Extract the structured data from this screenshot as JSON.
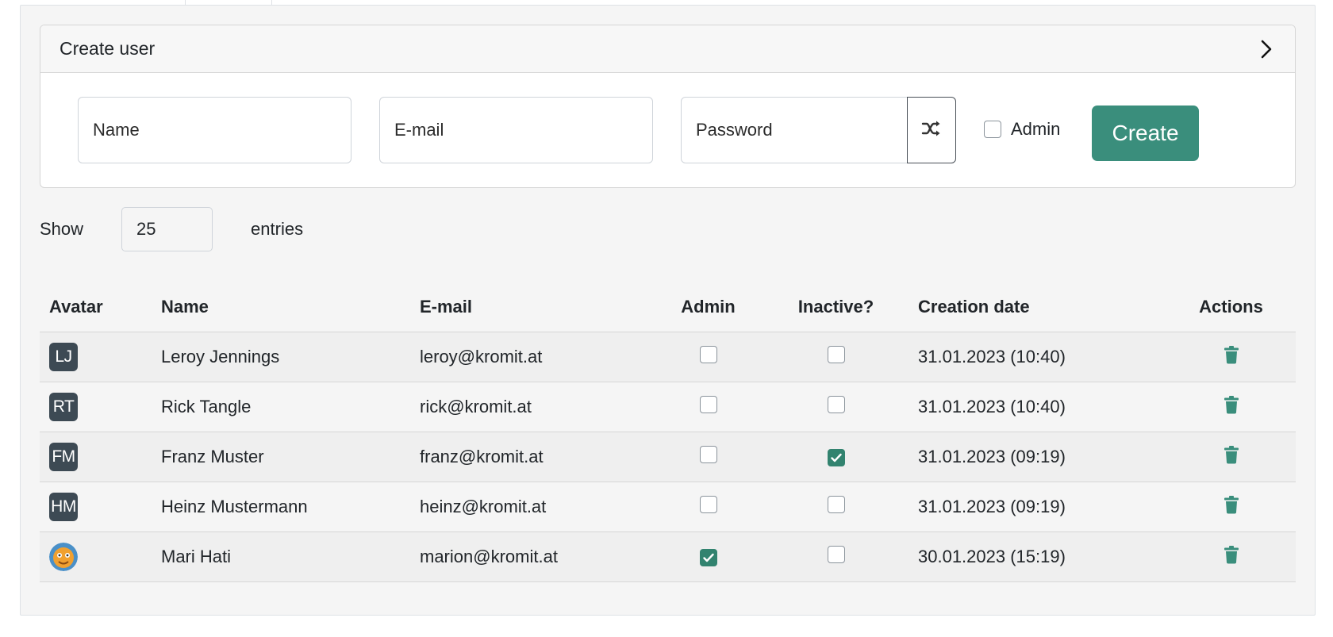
{
  "create_user": {
    "title": "Create user",
    "name_placeholder": "Name",
    "email_placeholder": "E-mail",
    "password_placeholder": "Password",
    "admin_label": "Admin",
    "admin_checked": false,
    "create_label": "Create"
  },
  "entries": {
    "show_label": "Show",
    "value": "25",
    "entries_label": "entries"
  },
  "table": {
    "headers": {
      "avatar": "Avatar",
      "name": "Name",
      "email": "E-mail",
      "admin": "Admin",
      "inactive": "Inactive?",
      "creation_date": "Creation date",
      "actions": "Actions"
    },
    "rows": [
      {
        "initials": "LJ",
        "name": "Leroy Jennings",
        "email": "leroy@kromit.at",
        "admin": false,
        "inactive": false,
        "date": "31.01.2023 (10:40)"
      },
      {
        "initials": "RT",
        "name": "Rick Tangle",
        "email": "rick@kromit.at",
        "admin": false,
        "inactive": false,
        "date": "31.01.2023 (10:40)"
      },
      {
        "initials": "FM",
        "name": "Franz Muster",
        "email": "franz@kromit.at",
        "admin": false,
        "inactive": true,
        "date": "31.01.2023 (09:19)"
      },
      {
        "initials": "HM",
        "name": "Heinz Mustermann",
        "email": "heinz@kromit.at",
        "admin": false,
        "inactive": false,
        "date": "31.01.2023 (09:19)"
      },
      {
        "initials": "",
        "avatar_icon": "photo-avatar-icon",
        "name": "Mari Hati",
        "email": "marion@kromit.at",
        "admin": true,
        "inactive": false,
        "date": "30.01.2023 (15:19)"
      }
    ]
  },
  "colors": {
    "accent": "#3a8e7c",
    "checkbox_checked": "#32836f",
    "avatar_bg": "#3d4a54"
  },
  "icons": {
    "header_toggle": "chevron-right-icon",
    "password_generate": "shuffle-icon",
    "row_delete": "trash-icon"
  }
}
